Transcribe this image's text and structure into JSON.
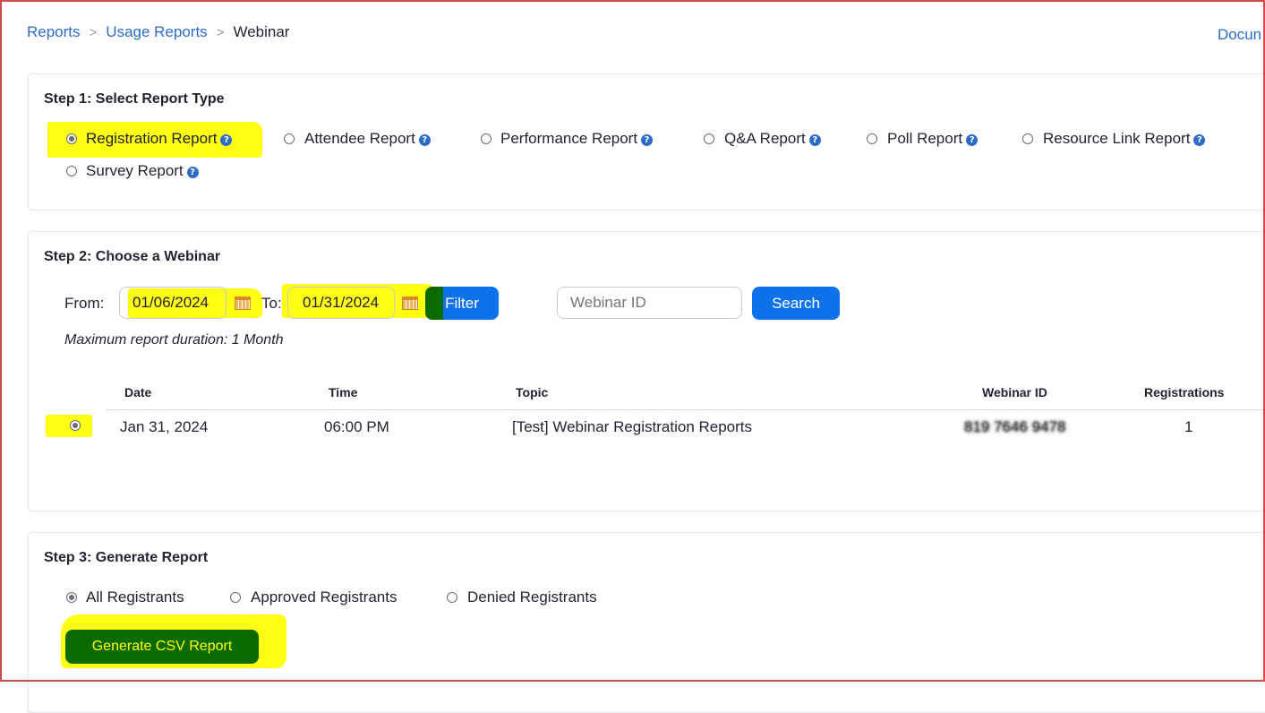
{
  "breadcrumb": {
    "items": [
      "Reports",
      "Usage Reports",
      "Webinar"
    ],
    "separator": ">"
  },
  "top_right_link": "Docun",
  "step1": {
    "title": "Step 1: Select Report Type",
    "options": [
      {
        "label": "Registration Report",
        "checked": true
      },
      {
        "label": "Attendee Report",
        "checked": false
      },
      {
        "label": "Performance Report",
        "checked": false
      },
      {
        "label": "Q&A Report",
        "checked": false
      },
      {
        "label": "Poll Report",
        "checked": false
      },
      {
        "label": "Resource Link Report",
        "checked": false
      },
      {
        "label": "Survey Report",
        "checked": false
      }
    ],
    "help_glyph": "?"
  },
  "step2": {
    "title": "Step 2: Choose a Webinar",
    "from_label": "From:",
    "from_value": "01/06/2024",
    "to_label": "To:",
    "to_value": "01/31/2024",
    "filter_label": "Filter",
    "webinar_id_placeholder": "Webinar ID",
    "search_label": "Search",
    "note": "Maximum report duration: 1 Month",
    "table": {
      "headers": [
        "Date",
        "Time",
        "Topic",
        "Webinar ID",
        "Registrations"
      ],
      "rows": [
        {
          "date": "Jan 31, 2024",
          "time": "06:00 PM",
          "topic": "[Test] Webinar Registration Reports",
          "webinar_id": "819 7646 9478",
          "registrations": "1",
          "selected": true
        }
      ]
    }
  },
  "step3": {
    "title": "Step 3: Generate Report",
    "options": [
      {
        "label": "All Registrants",
        "checked": true
      },
      {
        "label": "Approved Registrants",
        "checked": false
      },
      {
        "label": "Denied Registrants",
        "checked": false
      }
    ],
    "generate_label": "Generate CSV Report"
  },
  "colors": {
    "link": "#2d6bc7",
    "primary_button": "#0e72ed",
    "highlight": "#ffff00",
    "annotation_green": "#0b6b00",
    "frame": "#d24a4a"
  }
}
